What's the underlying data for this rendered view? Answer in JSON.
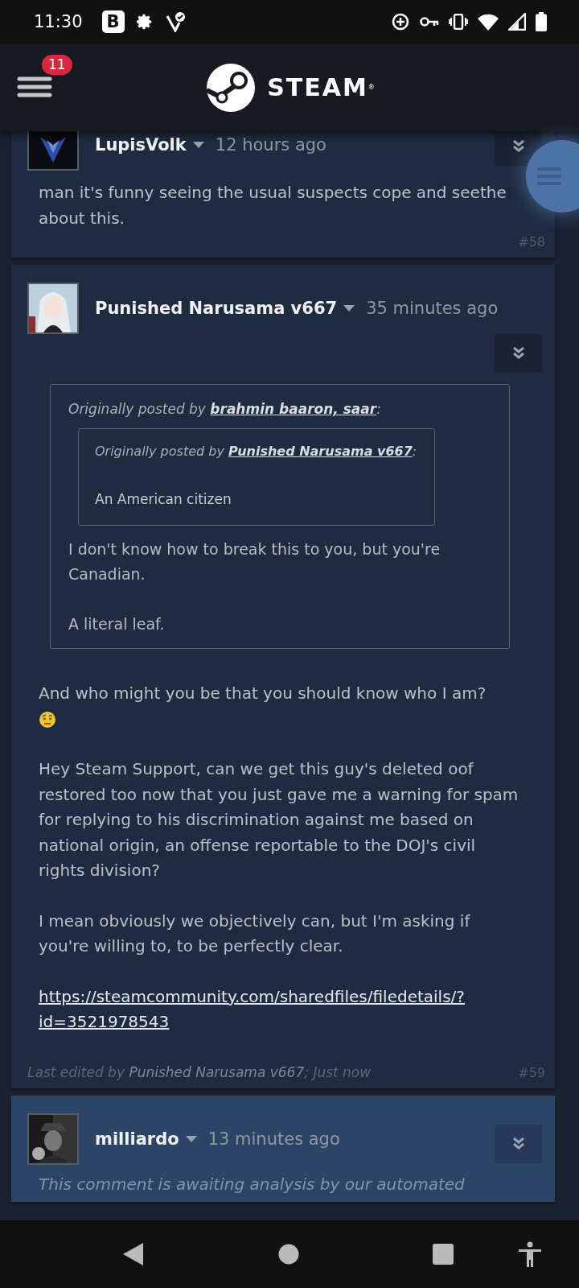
{
  "status_bar": {
    "time": "11:30",
    "app_letter": "B"
  },
  "header": {
    "menu_badge": "11",
    "logo": "STEAM",
    "logo_mark": "®"
  },
  "posts": [
    {
      "author": "LupisVolk",
      "time": "12 hours ago",
      "highlighted": false,
      "paragraphs": [
        {
          "kind": "text",
          "text": "man it's funny seeing the usual suspects cope and seethe about this."
        }
      ],
      "number": "#58"
    },
    {
      "author": "Punished Narusama v667",
      "time": "35 minutes ago",
      "highlighted": false,
      "quote": {
        "intro": "Originally posted by",
        "author": "brahmin baaron, saar",
        "suffix": ":",
        "quote": {
          "intro": "Originally posted by",
          "author": "Punished Narusama v667",
          "suffix": ":",
          "paragraphs": [
            "An American citizen"
          ]
        },
        "paragraphs": [
          "I don't know how to break this to you, but you're Canadian.",
          "A literal leaf."
        ]
      },
      "paragraphs": [
        {
          "kind": "text",
          "text": "And who might you be that you should know who I am?",
          "trailing_emoji": true
        },
        {
          "kind": "text",
          "text": "Hey Steam Support, can we get this guy's deleted oof restored too now that you just gave me a warning for spam for replying to his discrimination against me based on national origin, an offense reportable to the DOJ's civil rights division?"
        },
        {
          "kind": "text",
          "text": "I mean obviously we objectively can, but I'm asking if you're willing to, to be perfectly clear."
        },
        {
          "kind": "link",
          "text": "https://steamcommunity.com/sharedfiles/filedetails/?id=3521978543"
        }
      ],
      "edited": {
        "prefix": "Last edited by",
        "author": "Punished Narusama v667",
        "suffix": "; Just now"
      },
      "number": "#59"
    },
    {
      "author": "milliardo",
      "time": "13 minutes ago",
      "highlighted": true,
      "paragraphs": [
        {
          "kind": "pending",
          "text": "This comment is awaiting analysis by our automated"
        }
      ]
    }
  ]
}
